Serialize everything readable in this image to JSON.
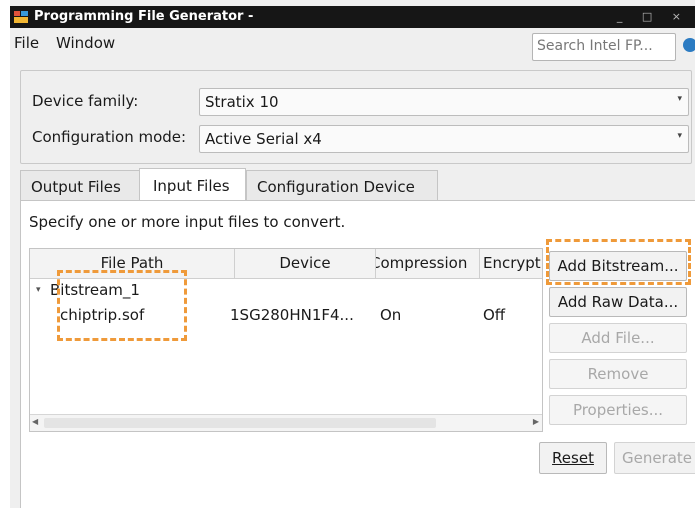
{
  "window": {
    "title": "Programming File Generator -",
    "controls": "_ □ ×"
  },
  "menu": {
    "file": "File",
    "window": "Window"
  },
  "search": {
    "placeholder": "Search Intel FP..."
  },
  "device": {
    "family_label": "Device family:",
    "family_value": "Stratix 10",
    "config_label": "Configuration mode:",
    "config_value": "Active Serial x4"
  },
  "tabs": [
    {
      "label": "Output Files",
      "active": false
    },
    {
      "label": "Input Files",
      "active": true
    },
    {
      "label": "Configuration Device",
      "active": false
    }
  ],
  "panel": {
    "hint": "Specify one or more input files to convert."
  },
  "table": {
    "columns": [
      "File Path",
      "Device",
      "Compression",
      "Encrypt"
    ],
    "group": "Bitstream_1",
    "rows": [
      {
        "file": "chiptrip.sof",
        "device": "1SG280HN1F4...",
        "compression": "On",
        "encrypt": "Off"
      }
    ]
  },
  "side_buttons": {
    "add_bitstream": "Add Bitstream...",
    "add_raw": "Add Raw Data...",
    "add_file": "Add File...",
    "remove": "Remove",
    "properties": "Properties..."
  },
  "bottom_buttons": {
    "reset": "Reset",
    "generate": "Generate"
  },
  "colors": {
    "highlight": "#ef9a3a",
    "titlebar": "#161616"
  }
}
